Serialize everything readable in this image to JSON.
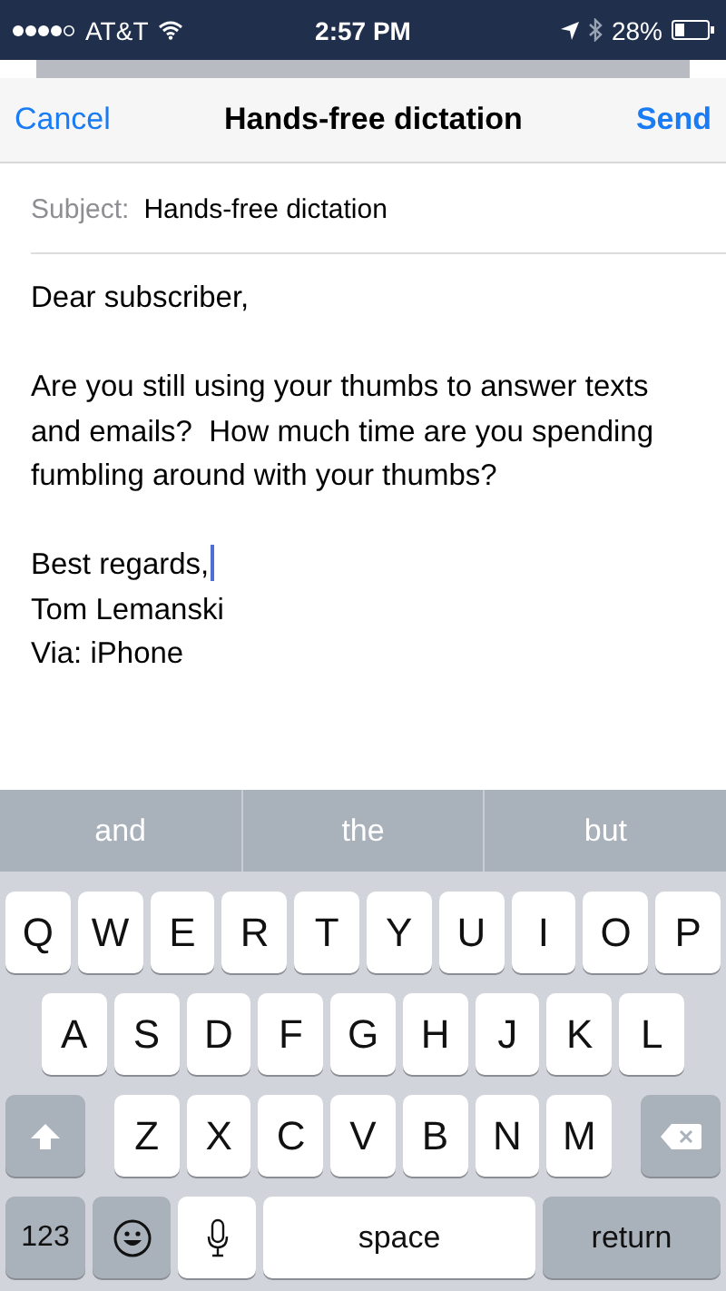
{
  "status_bar": {
    "carrier": "AT&T",
    "time": "2:57 PM",
    "battery": "28%"
  },
  "nav": {
    "cancel": "Cancel",
    "title": "Hands-free dictation",
    "send": "Send"
  },
  "subject": {
    "label": "Subject:",
    "value": "Hands-free dictation"
  },
  "body": [
    {
      "lines": [
        {
          "text": "Dear subscriber,",
          "cursor": false
        }
      ]
    },
    {
      "lines": [
        {
          "text": "Are you still using your thumbs to answer texts and emails?  How much time are you spending fumbling around with your thumbs?",
          "cursor": false
        }
      ]
    },
    {
      "lines": [
        {
          "text": "Best regards,",
          "cursor": true
        },
        {
          "text": "Tom Lemanski",
          "cursor": false
        },
        {
          "text": "Via: iPhone",
          "cursor": false
        }
      ]
    }
  ],
  "suggestions": [
    "and",
    "the",
    "but"
  ],
  "keyboard": {
    "rows": [
      [
        "Q",
        "W",
        "E",
        "R",
        "T",
        "Y",
        "U",
        "I",
        "O",
        "P"
      ],
      [
        "A",
        "S",
        "D",
        "F",
        "G",
        "H",
        "J",
        "K",
        "L"
      ],
      [
        "Z",
        "X",
        "C",
        "V",
        "B",
        "N",
        "M"
      ]
    ],
    "numbers": "123",
    "space": "space",
    "return": "return"
  }
}
